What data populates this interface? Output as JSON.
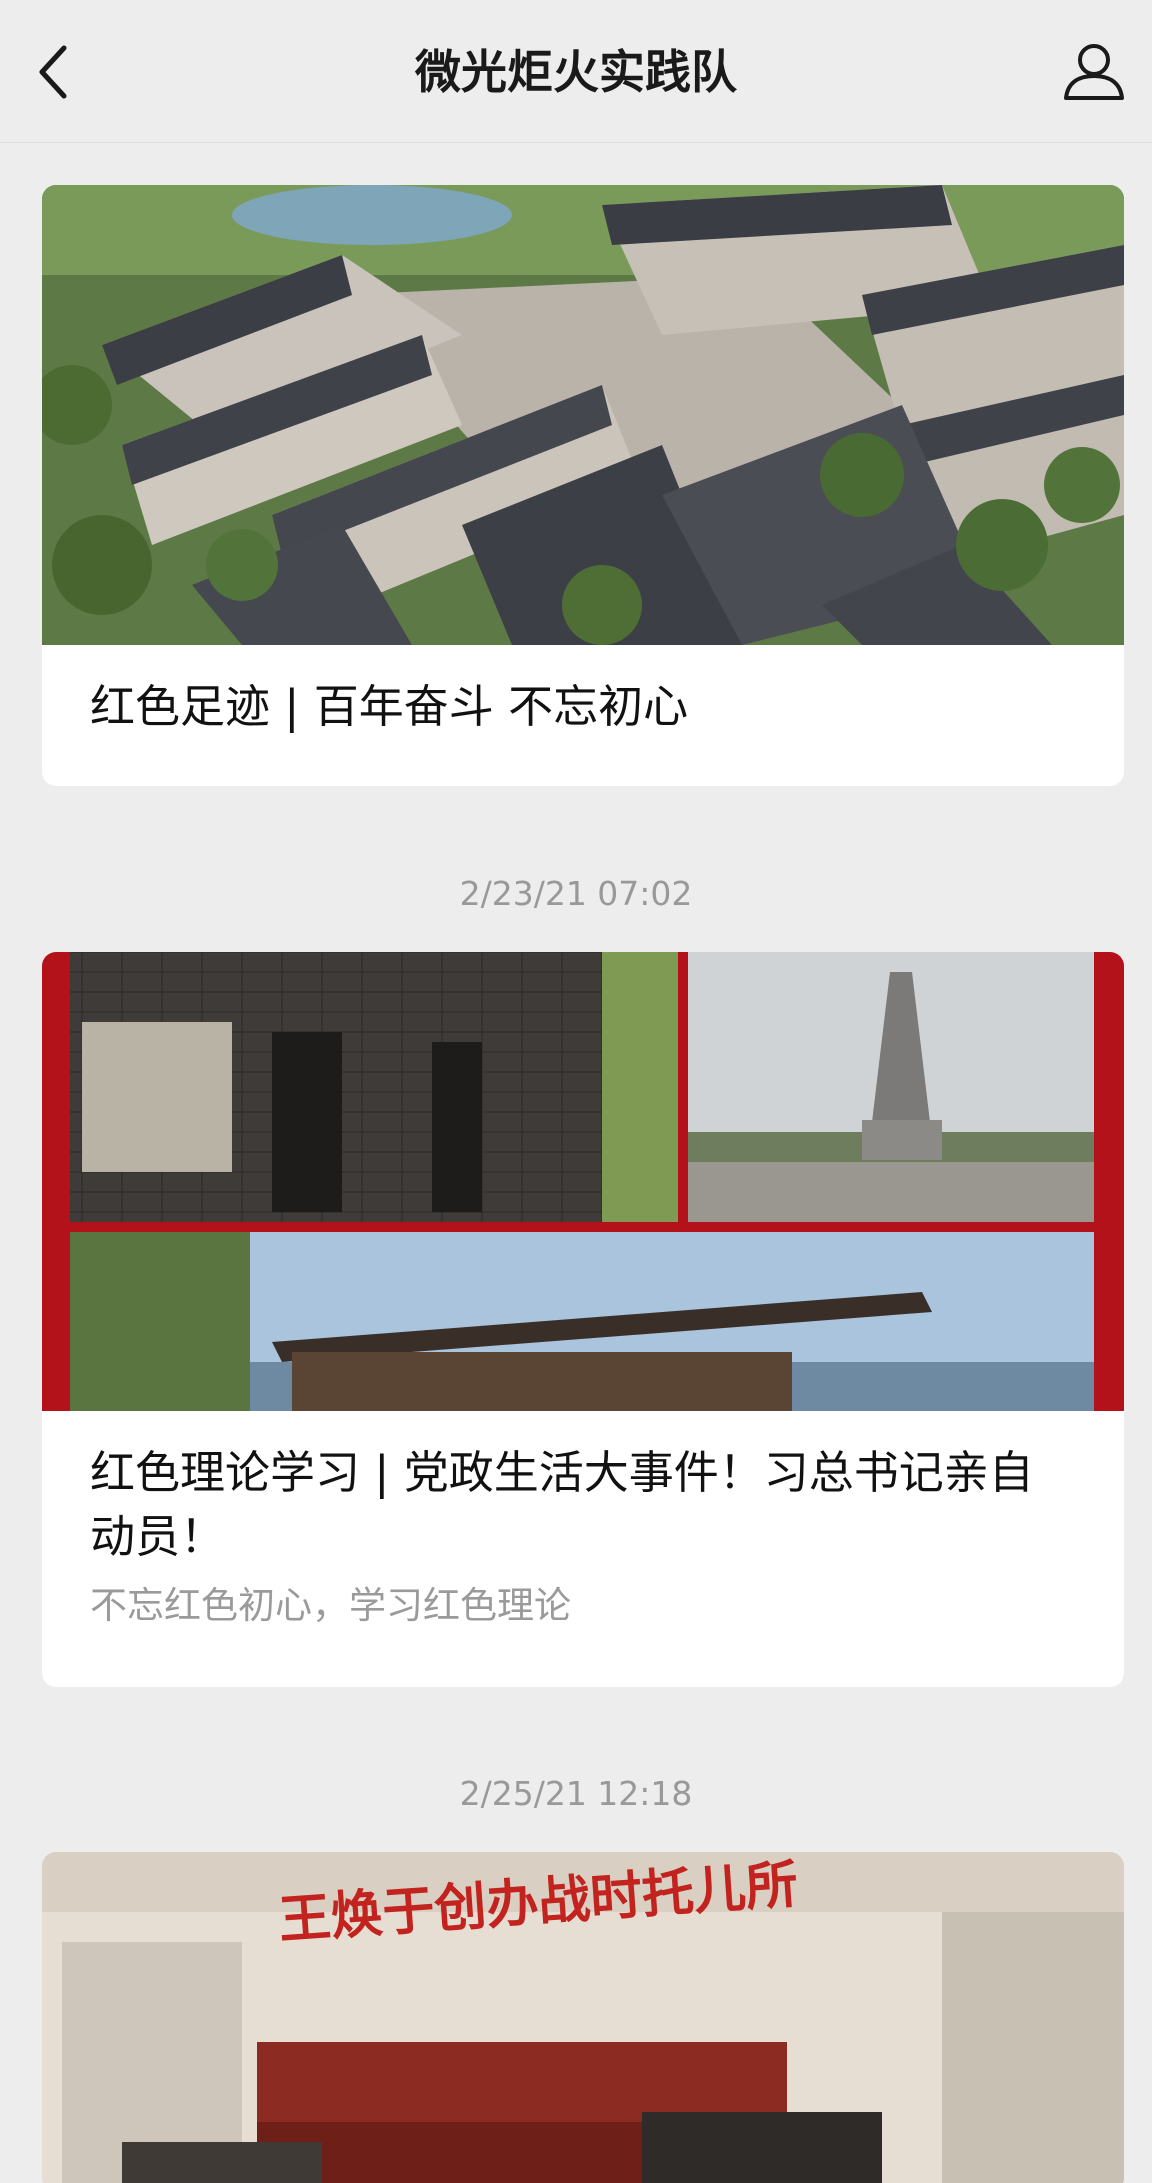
{
  "header": {
    "title": "微光炬火实践队"
  },
  "feed": {
    "article1": {
      "title": "红色足迹 | 百年奋斗 不忘初心"
    },
    "timestamp2": "2/23/21 07:02",
    "article2": {
      "title": "红色理论学习 | 党政生活大事件！习总书记亲自动员！",
      "digest": "不忘红色初心，学习红色理论"
    },
    "timestamp3": "2/25/21 12:18",
    "article3": {
      "banner_text": "王焕于创办战时托儿所"
    }
  },
  "icons": {
    "back": "chevron-left",
    "profile": "person-outline"
  },
  "colors": {
    "background": "#ededed",
    "card": "#ffffff",
    "title_text": "#111111",
    "meta_text": "#999999",
    "accent_red": "#b3121b"
  }
}
